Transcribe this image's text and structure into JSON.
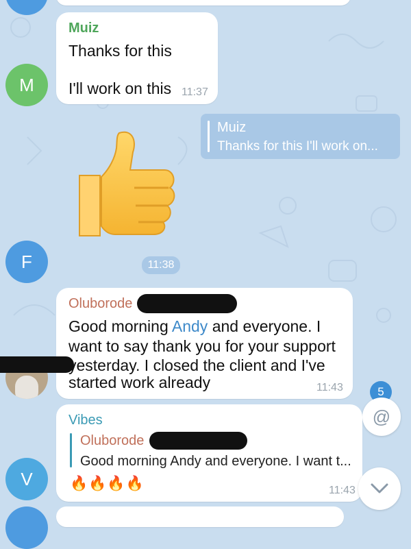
{
  "messages": [
    {
      "sender": "Muiz",
      "line1": "Thanks for this",
      "line2": "I'll work on this",
      "time": "11:37",
      "avatar_letter": "M"
    },
    {
      "reply_to_name": "Muiz",
      "reply_preview": "Thanks for this  I'll work on...",
      "sticker": "thumbs-up",
      "time": "11:38",
      "avatar_letter": "F"
    },
    {
      "sender": "Oluborode",
      "mention": "Andy",
      "line1_pre": "Good morning ",
      "line1_post": " and everyone.  I",
      "line2": "want to say thank you for your support",
      "line3": "yesterday.  I closed the client and I've",
      "line4": "started work already",
      "time": "11:43"
    },
    {
      "sender": "Vibes",
      "reply_to_name": "Oluborode",
      "reply_preview": "Good morning Andy and everyone.  I want t...",
      "emoji": "🔥🔥🔥🔥",
      "time": "11:43",
      "avatar_letter": "V"
    }
  ],
  "mentions_badge": {
    "count": "5",
    "icon": "at-icon"
  },
  "scroll_down": {
    "icon": "chevron-down-icon"
  },
  "colors": {
    "background": "#c9ddef",
    "muiz_name": "#4fa65b",
    "oluborode_name": "#c0705a",
    "vibes_name": "#3a9ab4",
    "mention": "#3d89c9",
    "avatar_m": "#6cc36a",
    "avatar_f": "#4e9be0",
    "avatar_v": "#4ea9e0"
  }
}
